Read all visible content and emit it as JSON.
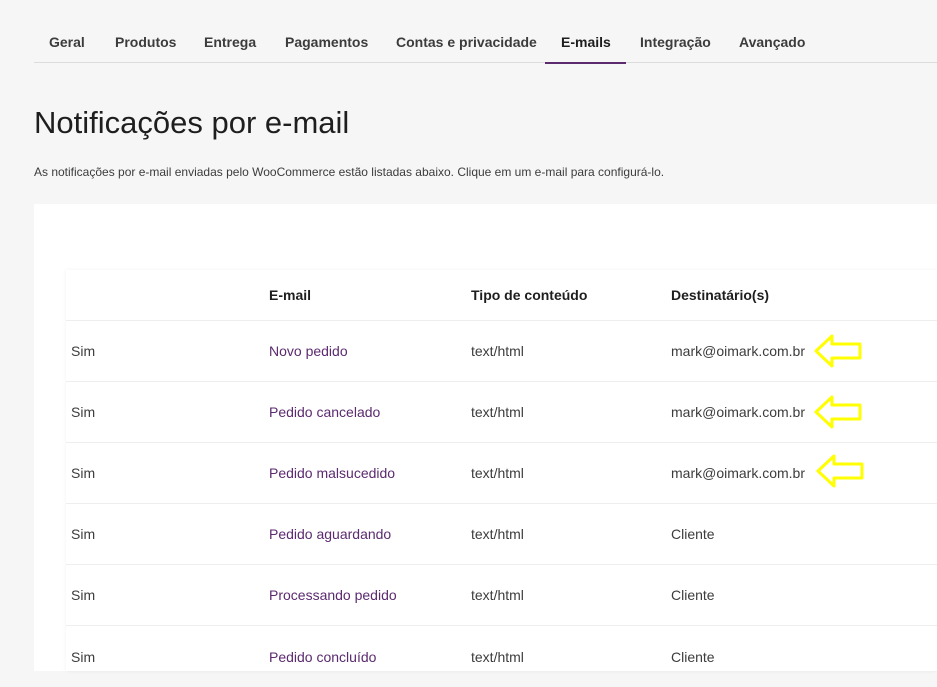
{
  "tabs": [
    {
      "label": "Geral",
      "active": false
    },
    {
      "label": "Produtos",
      "active": false
    },
    {
      "label": "Entrega",
      "active": false
    },
    {
      "label": "Pagamentos",
      "active": false
    },
    {
      "label": "Contas e privacidade",
      "active": false
    },
    {
      "label": "E-mails",
      "active": true
    },
    {
      "label": "Integração",
      "active": false
    },
    {
      "label": "Avançado",
      "active": false
    }
  ],
  "page": {
    "title": "Notificações por e-mail",
    "description": "As notificações por e-mail enviadas pelo WooCommerce estão listadas abaixo. Clique em um e-mail para configurá-lo."
  },
  "table": {
    "headers": [
      "",
      "E-mail",
      "Tipo de conteúdo",
      "Destinatário(s)"
    ],
    "rows": [
      {
        "enabled": "Sim",
        "email": "Novo pedido",
        "content_type": "text/html",
        "recipient": "mark@oimark.com.br"
      },
      {
        "enabled": "Sim",
        "email": "Pedido cancelado",
        "content_type": "text/html",
        "recipient": "mark@oimark.com.br"
      },
      {
        "enabled": "Sim",
        "email": "Pedido malsucedido",
        "content_type": "text/html",
        "recipient": "mark@oimark.com.br"
      },
      {
        "enabled": "Sim",
        "email": "Pedido aguardando",
        "content_type": "text/html",
        "recipient": "Cliente"
      },
      {
        "enabled": "Sim",
        "email": "Processando pedido",
        "content_type": "text/html",
        "recipient": "Cliente"
      },
      {
        "enabled": "Sim",
        "email": "Pedido concluído",
        "content_type": "text/html",
        "recipient": "Cliente"
      }
    ]
  },
  "annotations": {
    "arrow_icon": "arrow-left-icon",
    "arrow_color": "#ffff00",
    "arrow_rows": [
      0,
      1,
      2
    ]
  },
  "colors": {
    "accent": "#5b2a6f",
    "background": "#f6f6f6",
    "text": "#1e1e1e"
  }
}
